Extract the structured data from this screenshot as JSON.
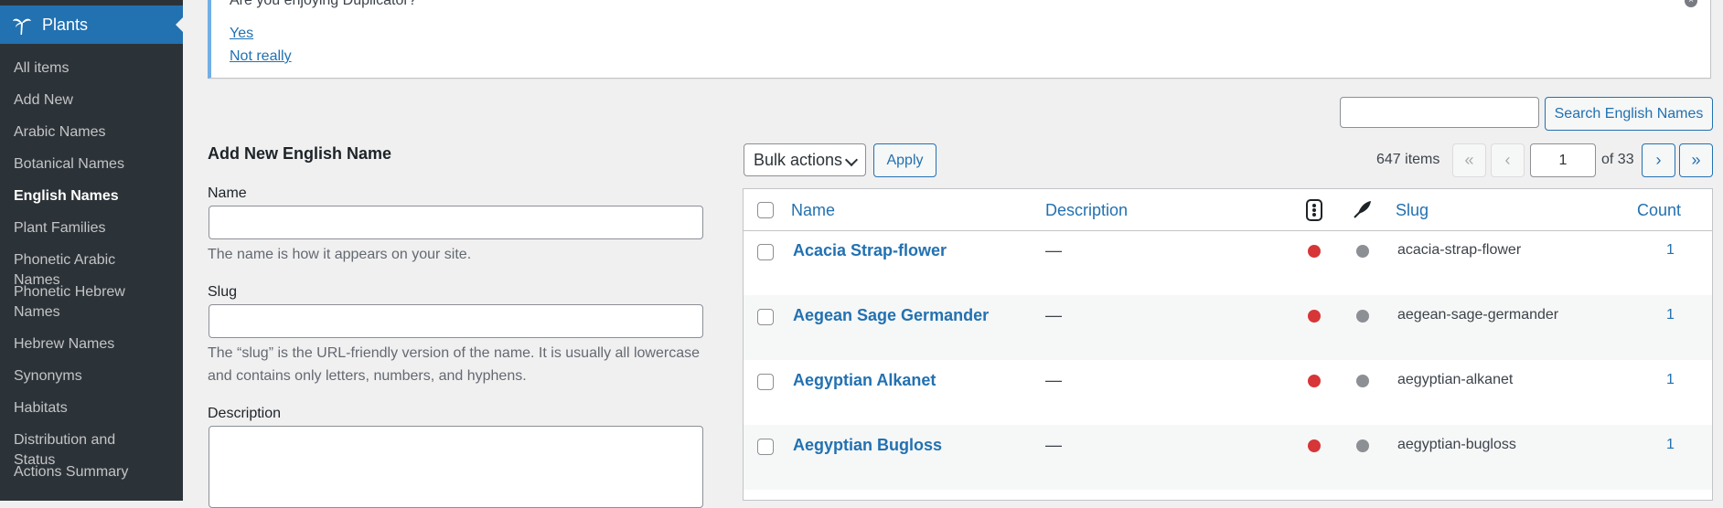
{
  "sidebar": {
    "menu_title": "Plants",
    "items": [
      {
        "label": "All items",
        "active": false
      },
      {
        "label": "Add New",
        "active": false
      },
      {
        "label": "Arabic Names",
        "active": false
      },
      {
        "label": "Botanical Names",
        "active": false
      },
      {
        "label": "English Names",
        "active": true
      },
      {
        "label": "Plant Families",
        "active": false
      },
      {
        "label": "Phonetic Arabic Names",
        "active": false
      },
      {
        "label": "Phonetic Hebrew Names",
        "active": false
      },
      {
        "label": "Hebrew Names",
        "active": false
      },
      {
        "label": "Synonyms",
        "active": false
      },
      {
        "label": "Habitats",
        "active": false
      },
      {
        "label": "Distribution and Status",
        "active": false
      },
      {
        "label": "Actions Summary",
        "active": false
      }
    ]
  },
  "notice": {
    "question": "Are you enjoying Duplicator?",
    "yes": "Yes",
    "no": "Not really"
  },
  "search": {
    "value": "",
    "button": "Search English Names"
  },
  "form": {
    "title": "Add New English Name",
    "name_label": "Name",
    "name_help": "The name is how it appears on your site.",
    "slug_label": "Slug",
    "slug_help": "The “slug” is the URL-friendly version of the name. It is usually all lowercase and contains only letters, numbers, and hyphens.",
    "description_label": "Description"
  },
  "bulk": {
    "selected": "Bulk actions",
    "apply": "Apply"
  },
  "pagination": {
    "items": "647 items",
    "first": "«",
    "prev": "‹",
    "current": "1",
    "of": "of 33",
    "next": "›",
    "last": "»"
  },
  "table": {
    "headers": {
      "name": "Name",
      "description": "Description",
      "slug": "Slug",
      "count": "Count"
    },
    "rows": [
      {
        "name": "Acacia Strap-flower",
        "description": "—",
        "slug": "acacia-strap-flower",
        "count": "1"
      },
      {
        "name": "Aegean Sage Germander",
        "description": "—",
        "slug": "aegean-sage-germander",
        "count": "1"
      },
      {
        "name": "Aegyptian Alkanet",
        "description": "—",
        "slug": "aegyptian-alkanet",
        "count": "1"
      },
      {
        "name": "Aegyptian Bugloss",
        "description": "—",
        "slug": "aegyptian-bugloss",
        "count": "1"
      }
    ]
  },
  "colors": {
    "accent": "#2271b1",
    "sidebar_bg": "#1d2327",
    "status_red": "#d63638",
    "status_grey": "#8c8f94"
  }
}
